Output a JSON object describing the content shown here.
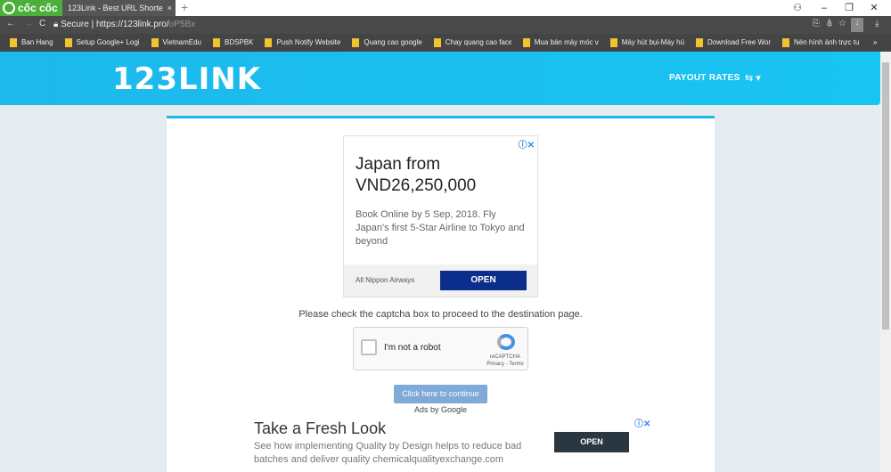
{
  "browser": {
    "brand": "cốc cốc",
    "tab_title": "123Link - Best URL Shorte",
    "tab_close": "×",
    "new_tab": "+",
    "secure_label": "Secure",
    "url_host": "https://123link.pro/",
    "url_path": "oP5Bx",
    "bookmarks": [
      "Ban Hang",
      "Setup Google+ Logi",
      "VietnamEdu",
      "BDSPBK",
      "Push Notify Website",
      "Quang cao google",
      "Chay quang cao face",
      "Mua bán máy móc v",
      "Máy hút bụi-Máy hú",
      "Download Free Wor",
      "Nén hình ảnh trực tu"
    ],
    "more": "»"
  },
  "header": {
    "logo": "123LINK",
    "payout_rates": "PAYOUT RATES",
    "lang_caret": "⇆ ▾"
  },
  "ad1": {
    "title": "Japan from VND26,250,000",
    "body": "Book Online by 5 Sep, 2018. Fly Japan's first 5-Star Airline to Tokyo and beyond",
    "advertiser": "All Nippon Airways",
    "open": "OPEN",
    "adchoices": "ⓘ✕"
  },
  "message": "Please check the captcha box to proceed to the destination page.",
  "captcha": {
    "label": "I'm not a robot",
    "brand": "reCAPTCHA",
    "links": "Privacy - Terms"
  },
  "continue_button": "Click here to continue",
  "ads_by": "Ads by Google",
  "ad2": {
    "title": "Take a Fresh Look",
    "body": "See how implementing Quality by Design helps to reduce bad batches and deliver quality chemicalqualityexchange.com",
    "open": "OPEN",
    "adchoices": "ⓘ✕"
  },
  "colors": {
    "header": "#1ec0f0",
    "ad_open": "#0b2d8c",
    "continue": "#7fa9d6"
  }
}
